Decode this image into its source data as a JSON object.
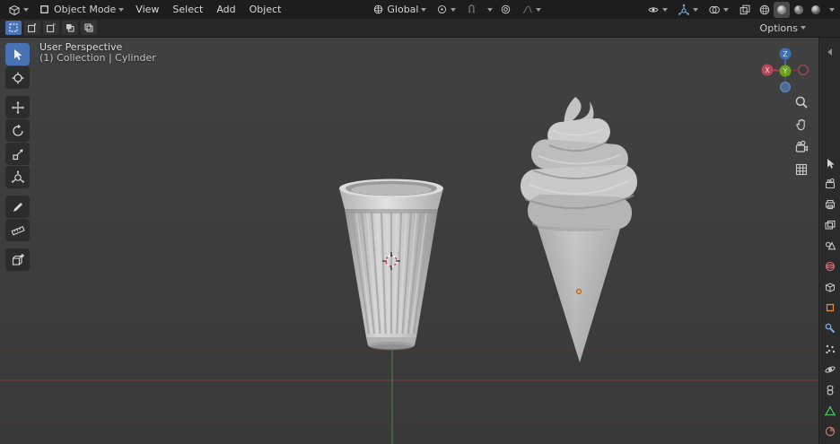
{
  "colors": {
    "accent": "#4772b3",
    "axis_x": "#b8475a",
    "axis_y": "#6ba21f",
    "axis_z": "#3f6fb5",
    "header_bg": "#1d1d1d",
    "viewport_bg": "#3b3b3b",
    "object_gray": "#c9c9c9"
  },
  "topbar": {
    "mode": "Object Mode",
    "menus": [
      {
        "label": "View"
      },
      {
        "label": "Select"
      },
      {
        "label": "Add"
      },
      {
        "label": "Object"
      }
    ],
    "orientation": "Global",
    "icons": [
      "editor-type-icon",
      "object-mode-icon",
      "orientation-globe-icon",
      "pivot-point-icon",
      "snap-magnet-icon",
      "proportional-edit-icon",
      "falloff-curve-icon",
      "visibility-eye-icon",
      "gizmo-icon",
      "overlays-icon",
      "xray-icon",
      "shading-wireframe-icon",
      "shading-solid-icon",
      "shading-material-icon",
      "shading-rendered-icon"
    ]
  },
  "tool_settings": {
    "options_label": "Options",
    "select_modes": [
      {
        "name": "Set"
      },
      {
        "name": "Extend"
      },
      {
        "name": "Subtract"
      },
      {
        "name": "Invert"
      },
      {
        "name": "Intersect"
      }
    ]
  },
  "tools": {
    "items": [
      {
        "name": "Select Box"
      },
      {
        "name": "Cursor"
      },
      {
        "name": "Move"
      },
      {
        "name": "Rotate"
      },
      {
        "name": "Scale"
      },
      {
        "name": "Transform"
      },
      {
        "name": "Annotate"
      },
      {
        "name": "Measure"
      },
      {
        "name": "Add Cube"
      }
    ]
  },
  "viewport": {
    "perspective": "User Perspective",
    "breadcrumb": "(1) Collection | Cylinder",
    "gizmo": {
      "x_label": "X",
      "y_label": "Y",
      "z_label": "Z"
    },
    "nav_icons": [
      "zoom-icon",
      "pan-hand-icon",
      "camera-view-icon",
      "ortho-grid-icon"
    ],
    "objects": [
      "fluted-cup-mesh",
      "soft-serve-ice-cream-cone-mesh",
      "3d-cursor",
      "object-origin-dot"
    ]
  },
  "properties_tabs": {
    "items": [
      {
        "name": "Active Tool"
      },
      {
        "name": "Render"
      },
      {
        "name": "Output"
      },
      {
        "name": "View Layer"
      },
      {
        "name": "Scene"
      },
      {
        "name": "World"
      },
      {
        "name": "Collection"
      },
      {
        "name": "Object"
      },
      {
        "name": "Modifiers"
      },
      {
        "name": "Particles"
      },
      {
        "name": "Physics"
      },
      {
        "name": "Constraints"
      },
      {
        "name": "Object Data"
      },
      {
        "name": "Material"
      }
    ]
  }
}
